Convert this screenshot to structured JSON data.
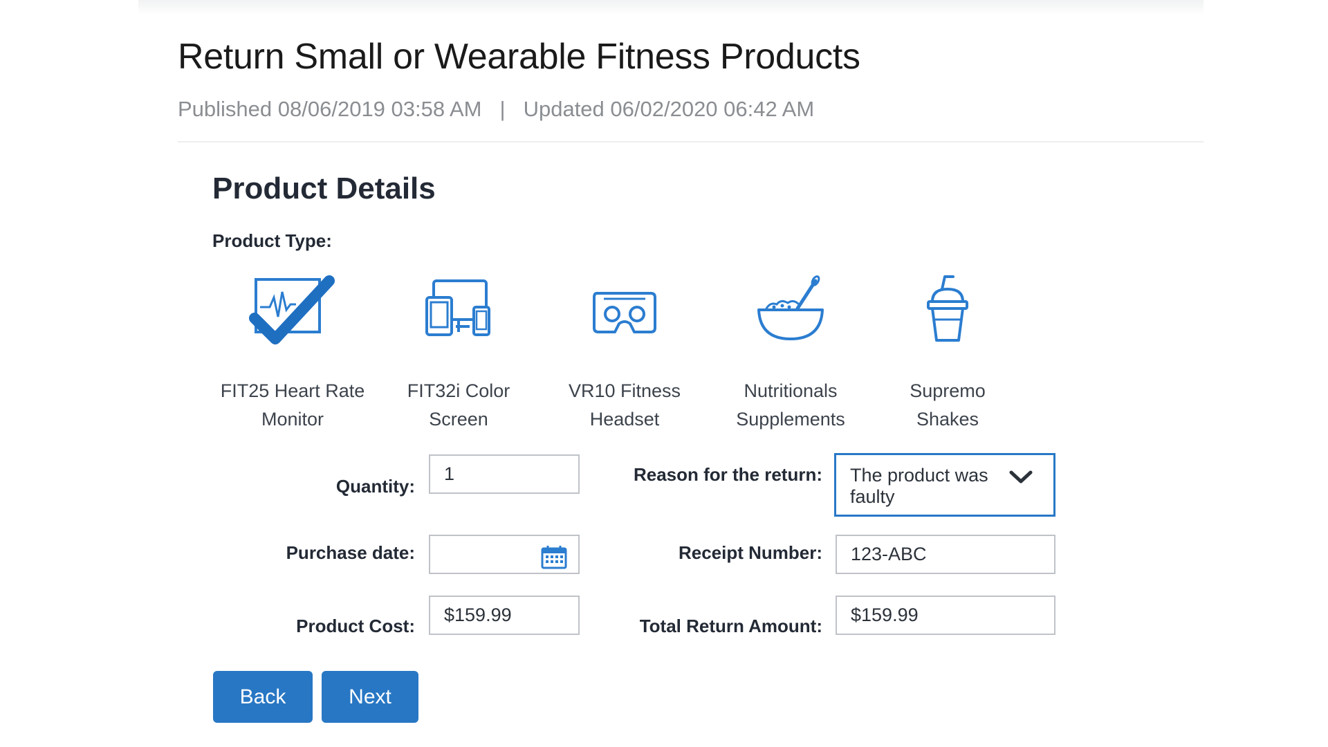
{
  "page": {
    "title": "Return Small or Wearable Fitness Products",
    "published": "Published 08/06/2019 03:58 AM",
    "separator": "|",
    "updated": "Updated 06/02/2020 06:42 AM"
  },
  "section": {
    "title": "Product Details",
    "product_type_label": "Product Type:"
  },
  "products": [
    {
      "line1": "FIT25 Heart Rate",
      "line2": "Monitor",
      "icon": "heart-rate-monitor-icon",
      "selected": true
    },
    {
      "line1": "FIT32i Color",
      "line2": "Screen",
      "icon": "devices-icon",
      "selected": false
    },
    {
      "line1": "VR10 Fitness",
      "line2": "Headset",
      "icon": "vr-headset-icon",
      "selected": false
    },
    {
      "line1": "Nutritionals",
      "line2": "Supplements",
      "icon": "bowl-icon",
      "selected": false
    },
    {
      "line1": "Supremo",
      "line2": "Shakes",
      "icon": "shake-cup-icon",
      "selected": false
    }
  ],
  "form": {
    "quantity_label": "Quantity:",
    "quantity_value": "1",
    "reason_label": "Reason for the return:",
    "reason_line1": "The product was",
    "reason_line2": "faulty",
    "purchase_date_label": "Purchase date:",
    "purchase_date_value": "",
    "receipt_label": "Receipt Number:",
    "receipt_value": "123-ABC",
    "cost_label": "Product Cost:",
    "cost_value": "$159.99",
    "total_label": "Total Return Amount:",
    "total_value": "$159.99"
  },
  "buttons": {
    "back": "Back",
    "next": "Next"
  },
  "colors": {
    "accent": "#2877c4",
    "icon_blue": "#2b7dd0",
    "text_dark": "#232a35",
    "meta_gray": "#8a8d91"
  }
}
